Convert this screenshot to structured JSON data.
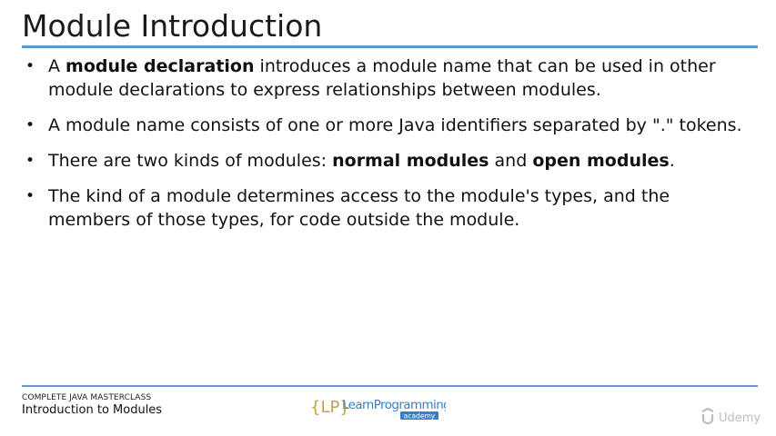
{
  "slide": {
    "title": "Module Introduction"
  },
  "bullets": [
    {
      "parts": [
        {
          "text": "A ",
          "bold": false
        },
        {
          "text": "module declaration",
          "bold": true
        },
        {
          "text": " introduces a module name that can be used in other module declarations to express relationships between modules.",
          "bold": false
        }
      ]
    },
    {
      "parts": [
        {
          "text": "A module name consists of one or more Java identifiers separated by \".\" tokens.",
          "bold": false
        }
      ]
    },
    {
      "parts": [
        {
          "text": "There are two kinds of modules: ",
          "bold": false
        },
        {
          "text": "normal modules",
          "bold": true
        },
        {
          "text": " and ",
          "bold": false
        },
        {
          "text": "open modules",
          "bold": true
        },
        {
          "text": ".",
          "bold": false
        }
      ]
    },
    {
      "parts": [
        {
          "text": "The kind of a module determines access to the module's types, and the members of those types, for code outside the module.",
          "bold": false
        }
      ]
    }
  ],
  "footer": {
    "course": "COMPLETE JAVA MASTERCLASS",
    "lecture": "Introduction to Modules",
    "logo_bracket": "{LP}",
    "logo_name": "LearnProgramming",
    "logo_sub": "academy",
    "watermark": "Udemy"
  },
  "colors": {
    "accent": "#5b9bd5",
    "logo_blue": "#3a7fc4",
    "logo_gold": "#c8a24a"
  }
}
